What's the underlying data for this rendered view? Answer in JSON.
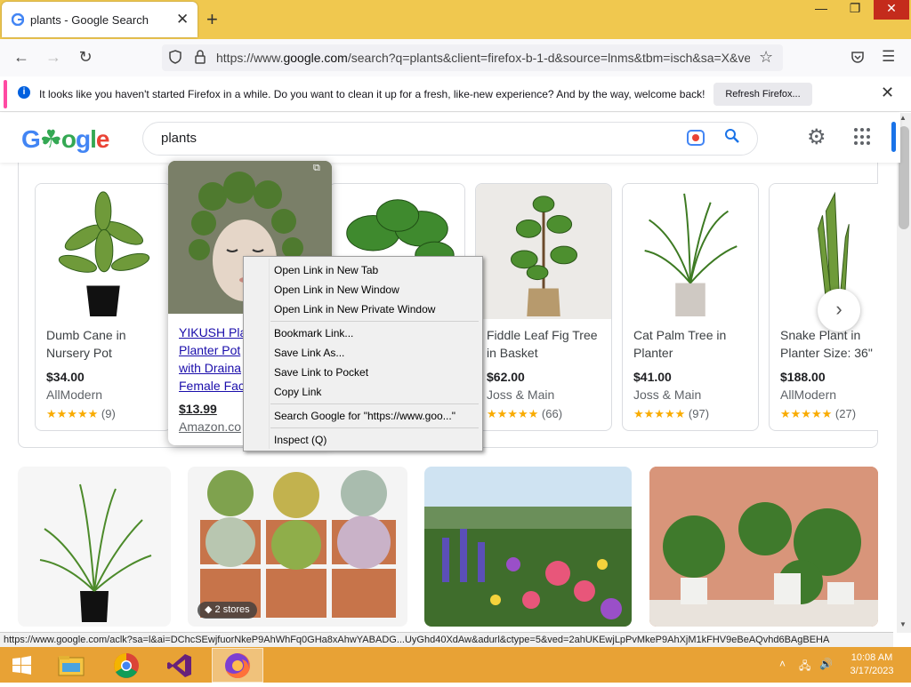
{
  "browser": {
    "tab_title": "plants - Google Search",
    "tab_close": "✕",
    "new_tab": "+",
    "url_prefix": "https://www.",
    "url_host": "google.com",
    "url_rest": "/search?q=plants&client=firefox-b-1-d&source=lnms&tbm=isch&sa=X&ved"
  },
  "notification": {
    "text": "It looks like you haven't started Firefox in a while. Do you want to clean it up for a fresh, like-new experience? And by the way, welcome back!",
    "button": "Refresh Firefox...",
    "close": "✕"
  },
  "google": {
    "logo": "Google",
    "query": "plants"
  },
  "products": [
    {
      "name": "Dumb Cane in Nursery Pot",
      "price": "$34.00",
      "store": "AllModern",
      "stars": "★★★★★",
      "count": "(9)"
    },
    {
      "name": "YIKUSH Plant Planter Pot with Drainage Female Face",
      "price": "$13.99",
      "store": "Amazon.com",
      "stars": "",
      "count": ""
    },
    {
      "name": "",
      "price": "",
      "store": "",
      "stars": "",
      "count": ""
    },
    {
      "name": "Fiddle Leaf Fig Tree in Basket",
      "price": "$62.00",
      "store": "Joss & Main",
      "stars": "★★★★★",
      "count": "(66)"
    },
    {
      "name": "Cat Palm Tree in Planter",
      "price": "$41.00",
      "store": "Joss & Main",
      "stars": "★★★★★",
      "count": "(97)"
    },
    {
      "name": "Snake Plant in Planter Size: 36\"",
      "price": "$188.00",
      "store": "AllModern",
      "stars": "★★★★★",
      "count": "(27)"
    }
  ],
  "hover_card": {
    "name": "YIKUSH Pla... Planter Pot... with Draina... Female Fac...",
    "name_lines": [
      "YIKUSH Pla",
      "Planter Pot",
      "with Draina",
      "Female Fac"
    ],
    "price": "$13.99",
    "store": "Amazon.co"
  },
  "context_menu": [
    {
      "label": "Open Link in New Tab"
    },
    {
      "label": "Open Link in New Window"
    },
    {
      "label": "Open Link in New Private Window"
    },
    {
      "label": "Bookmark Link..."
    },
    {
      "label": "Save Link As..."
    },
    {
      "label": "Save Link to Pocket"
    },
    {
      "label": "Copy Link"
    },
    {
      "label": "Search Google for \"https://www.goo...\""
    },
    {
      "label": "Inspect (Q)"
    }
  ],
  "images": {
    "badge": "2 stores"
  },
  "status_bar": "https://www.google.com/aclk?sa=l&ai=DChcSEwjfuorNkeP9AhWhFq0GHa8xAhwYABADG...UyGhd40XdAw&adurl&ctype=5&ved=2ahUKEwjLpPvMkeP9AhXjM1kFHV9eBeAQvhd6BAgBEHA",
  "taskbar": {
    "time": "10:08 AM",
    "date": "3/17/2023"
  },
  "colors": {
    "titlebar": "#f0c84f",
    "taskbar": "#e8a235",
    "link": "#1a0dab",
    "star": "#f9ab00"
  }
}
